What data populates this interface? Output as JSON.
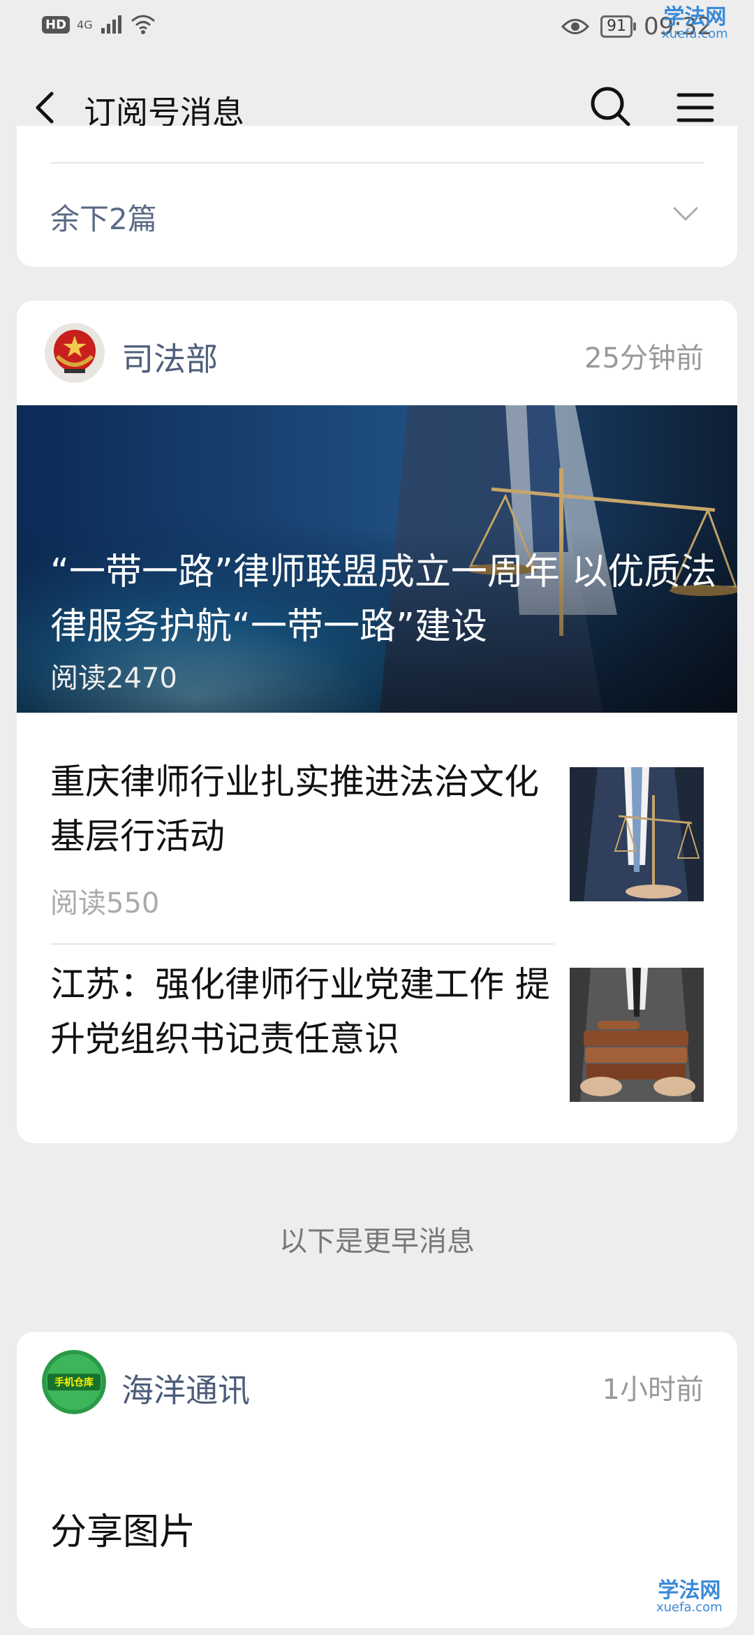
{
  "status_bar": {
    "hd_label": "HD",
    "network": "4G",
    "time": "09:32",
    "battery": "91"
  },
  "watermark": {
    "line1": "学法网",
    "line2": "xuefa.com"
  },
  "nav": {
    "title": "订阅号消息",
    "back_icon": "back-arrow-icon",
    "search_icon": "search-icon",
    "menu_icon": "menu-icon"
  },
  "collapsed_card": {
    "more_label": "余下2篇"
  },
  "main_card": {
    "account": "司法部",
    "time": "25分钟前",
    "headline": "“一带一路”律师联盟成立一周年 以优质法律服务护航“一带一路”建设",
    "headline_reads": "阅读2470",
    "articles": [
      {
        "title": "重庆律师行业扎实推进法治文化基层行活动",
        "reads": "阅读550"
      },
      {
        "title": "江苏：强化律师行业党建工作 提升党组织书记责任意识",
        "reads": ""
      }
    ]
  },
  "earlier_label": "以下是更早消息",
  "third_card": {
    "account": "海洋通讯",
    "time": "1小时前",
    "avatar_text": "手机仓库",
    "message": "分享图片"
  }
}
